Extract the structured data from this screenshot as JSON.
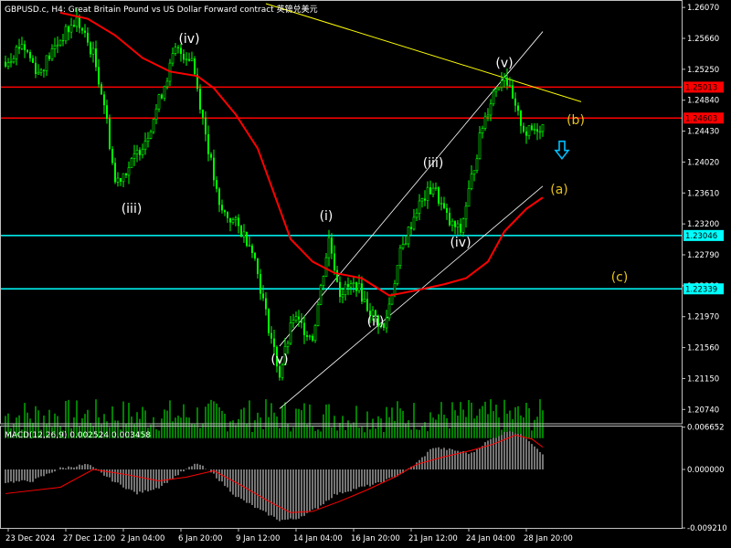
{
  "header": {
    "symbol_line": "GBPUSD.c, H4:  Great Britain Pound vs US Dollar Forward contract  英镑兑美元"
  },
  "colors": {
    "background": "#000000",
    "candle": "#00ff00",
    "volume": "#00ff00",
    "ma": "#ff0000",
    "red_level": "#ff0000",
    "cyan_level": "#00ffff",
    "trendline": "#ffff00",
    "channel": "#ffffff",
    "wave_labels": "#ffffff",
    "abc_labels": "#e6c21e",
    "arrow": "#00bfff",
    "macd_hist": "#c0c0c0",
    "macd_signal": "#ff0000"
  },
  "arrow_icon": "down-arrow-icon",
  "chart_data": [
    {
      "type": "candlestick",
      "title": "GBPUSD.c, H4:  Great Britain Pound vs US Dollar Forward contract  英镑兑美元",
      "ylim": [
        1.2055,
        1.2612
      ],
      "y_ticks": [
        "1.26070",
        "1.25660",
        "1.25250",
        "1.24840",
        "1.24430",
        "1.24020",
        "1.23610",
        "1.23200",
        "1.22790",
        "1.22380",
        "1.21970",
        "1.21560",
        "1.21150",
        "1.20740"
      ],
      "x_ticks": [
        "23 Dec 2024",
        "27 Dec 12:00",
        "2 Jan 04:00",
        "6 Jan 20:00",
        "9 Jan 12:00",
        "14 Jan 04:00",
        "16 Jan 20:00",
        "21 Jan 12:00",
        "24 Jan 04:00",
        "28 Jan 20:00"
      ],
      "price_levels": [
        {
          "value": 1.25013,
          "label": "1.25013",
          "color": "#ff0000"
        },
        {
          "value": 1.24603,
          "label": "1.24603",
          "color": "#ff0000"
        },
        {
          "value": 1.23046,
          "label": "1.23046",
          "color": "#00ffff"
        },
        {
          "value": 1.22339,
          "label": "1.22339",
          "color": "#00ffff"
        }
      ],
      "close_path": [
        {
          "bar": 0,
          "price": 1.2535
        },
        {
          "bar": 6,
          "price": 1.256
        },
        {
          "bar": 12,
          "price": 1.252
        },
        {
          "bar": 20,
          "price": 1.2565
        },
        {
          "bar": 26,
          "price": 1.259
        },
        {
          "bar": 32,
          "price": 1.2545
        },
        {
          "bar": 36,
          "price": 1.248
        },
        {
          "bar": 40,
          "price": 1.2375
        },
        {
          "bar": 46,
          "price": 1.24
        },
        {
          "bar": 52,
          "price": 1.244
        },
        {
          "bar": 58,
          "price": 1.2505
        },
        {
          "bar": 62,
          "price": 1.255
        },
        {
          "bar": 68,
          "price": 1.254
        },
        {
          "bar": 74,
          "price": 1.242
        },
        {
          "bar": 78,
          "price": 1.234
        },
        {
          "bar": 84,
          "price": 1.232
        },
        {
          "bar": 90,
          "price": 1.229
        },
        {
          "bar": 95,
          "price": 1.22
        },
        {
          "bar": 100,
          "price": 1.212
        },
        {
          "bar": 105,
          "price": 1.2195
        },
        {
          "bar": 112,
          "price": 1.217
        },
        {
          "bar": 118,
          "price": 1.23
        },
        {
          "bar": 122,
          "price": 1.223
        },
        {
          "bar": 128,
          "price": 1.224
        },
        {
          "bar": 132,
          "price": 1.221
        },
        {
          "bar": 138,
          "price": 1.218
        },
        {
          "bar": 144,
          "price": 1.228
        },
        {
          "bar": 150,
          "price": 1.234
        },
        {
          "bar": 156,
          "price": 1.237
        },
        {
          "bar": 162,
          "price": 1.232
        },
        {
          "bar": 166,
          "price": 1.231
        },
        {
          "bar": 170,
          "price": 1.238
        },
        {
          "bar": 174,
          "price": 1.245
        },
        {
          "bar": 178,
          "price": 1.2495
        },
        {
          "bar": 182,
          "price": 1.252
        },
        {
          "bar": 186,
          "price": 1.247
        },
        {
          "bar": 190,
          "price": 1.244
        },
        {
          "bar": 195,
          "price": 1.245
        }
      ],
      "moving_average": [
        {
          "bar": 20,
          "price": 1.26
        },
        {
          "bar": 30,
          "price": 1.2592
        },
        {
          "bar": 40,
          "price": 1.257
        },
        {
          "bar": 50,
          "price": 1.254
        },
        {
          "bar": 60,
          "price": 1.2522
        },
        {
          "bar": 70,
          "price": 1.2516
        },
        {
          "bar": 76,
          "price": 1.25
        },
        {
          "bar": 84,
          "price": 1.2465
        },
        {
          "bar": 92,
          "price": 1.242
        },
        {
          "bar": 98,
          "price": 1.236
        },
        {
          "bar": 104,
          "price": 1.23
        },
        {
          "bar": 112,
          "price": 1.227
        },
        {
          "bar": 120,
          "price": 1.2255
        },
        {
          "bar": 130,
          "price": 1.2248
        },
        {
          "bar": 140,
          "price": 1.2225
        },
        {
          "bar": 150,
          "price": 1.2232
        },
        {
          "bar": 160,
          "price": 1.224
        },
        {
          "bar": 168,
          "price": 1.2248
        },
        {
          "bar": 176,
          "price": 1.227
        },
        {
          "bar": 182,
          "price": 1.231
        },
        {
          "bar": 190,
          "price": 1.234
        },
        {
          "bar": 196,
          "price": 1.2355
        }
      ],
      "trendline": [
        {
          "bar": 95,
          "price": 1.2612
        },
        {
          "bar": 210,
          "price": 1.2482
        }
      ],
      "channel": [
        [
          {
            "bar": 100,
            "price": 1.2158
          },
          {
            "bar": 196,
            "price": 1.2575
          }
        ],
        [
          {
            "bar": 100,
            "price": 1.2075
          },
          {
            "bar": 196,
            "price": 1.237
          }
        ]
      ],
      "wave_labels": [
        {
          "text": "(iv)",
          "bar": 67,
          "price": 1.256
        },
        {
          "text": "(iii)",
          "bar": 46,
          "price": 1.2335
        },
        {
          "text": "(v)",
          "bar": 100,
          "price": 1.2135
        },
        {
          "text": "(i)",
          "bar": 117,
          "price": 1.2325
        },
        {
          "text": "(ii)",
          "bar": 135,
          "price": 1.2185
        },
        {
          "text": "(iii)",
          "bar": 156,
          "price": 1.2395
        },
        {
          "text": "(iv)",
          "bar": 166,
          "price": 1.229
        },
        {
          "text": "(v)",
          "bar": 182,
          "price": 1.2528
        }
      ],
      "abc_labels": [
        {
          "text": "(b)",
          "bar": 208,
          "price": 1.2452
        },
        {
          "text": "(a)",
          "bar": 202,
          "price": 1.236
        },
        {
          "text": "(c)",
          "bar": 224,
          "price": 1.2244
        }
      ],
      "projection_arrow": {
        "bar": 203,
        "price": 1.2415
      },
      "volume_range": [
        1.2036,
        1.2088
      ]
    },
    {
      "type": "macd",
      "title": "MACD(12,26,9) 0.002524 0.003458",
      "indicator_name": "MACD(12,26,9)",
      "value": "0.002524",
      "signal_value": "0.003458",
      "ylim": [
        -0.0092,
        0.0069
      ],
      "y_ticks": [
        "0.006652",
        "0.000000",
        "-0.009210"
      ],
      "histogram_path": [
        {
          "bar": 0,
          "value": -0.002
        },
        {
          "bar": 10,
          "value": -0.0018
        },
        {
          "bar": 20,
          "value": 0.0002
        },
        {
          "bar": 30,
          "value": 0.0008
        },
        {
          "bar": 40,
          "value": -0.002
        },
        {
          "bar": 48,
          "value": -0.0038
        },
        {
          "bar": 56,
          "value": -0.0028
        },
        {
          "bar": 64,
          "value": -0.0005
        },
        {
          "bar": 70,
          "value": 0.001
        },
        {
          "bar": 76,
          "value": -0.0008
        },
        {
          "bar": 84,
          "value": -0.0042
        },
        {
          "bar": 92,
          "value": -0.0062
        },
        {
          "bar": 100,
          "value": -0.008
        },
        {
          "bar": 106,
          "value": -0.0078
        },
        {
          "bar": 114,
          "value": -0.006
        },
        {
          "bar": 120,
          "value": -0.004
        },
        {
          "bar": 128,
          "value": -0.003
        },
        {
          "bar": 136,
          "value": -0.0022
        },
        {
          "bar": 144,
          "value": -0.0008
        },
        {
          "bar": 150,
          "value": 0.001
        },
        {
          "bar": 156,
          "value": 0.0035
        },
        {
          "bar": 164,
          "value": 0.003
        },
        {
          "bar": 170,
          "value": 0.0025
        },
        {
          "bar": 176,
          "value": 0.0045
        },
        {
          "bar": 184,
          "value": 0.0062
        },
        {
          "bar": 190,
          "value": 0.005
        },
        {
          "bar": 196,
          "value": 0.0025
        }
      ],
      "signal_path": [
        {
          "bar": 0,
          "value": -0.0038
        },
        {
          "bar": 20,
          "value": -0.0028
        },
        {
          "bar": 32,
          "value": 0.0
        },
        {
          "bar": 44,
          "value": -0.0008
        },
        {
          "bar": 56,
          "value": -0.0018
        },
        {
          "bar": 66,
          "value": -0.0012
        },
        {
          "bar": 76,
          "value": -0.0002
        },
        {
          "bar": 86,
          "value": -0.0025
        },
        {
          "bar": 96,
          "value": -0.005
        },
        {
          "bar": 104,
          "value": -0.0068
        },
        {
          "bar": 112,
          "value": -0.0066
        },
        {
          "bar": 122,
          "value": -0.005
        },
        {
          "bar": 132,
          "value": -0.0032
        },
        {
          "bar": 142,
          "value": -0.0012
        },
        {
          "bar": 150,
          "value": 0.0008
        },
        {
          "bar": 160,
          "value": 0.002
        },
        {
          "bar": 170,
          "value": 0.003
        },
        {
          "bar": 178,
          "value": 0.004
        },
        {
          "bar": 186,
          "value": 0.0054
        },
        {
          "bar": 192,
          "value": 0.0048
        },
        {
          "bar": 196,
          "value": 0.0035
        }
      ]
    }
  ]
}
